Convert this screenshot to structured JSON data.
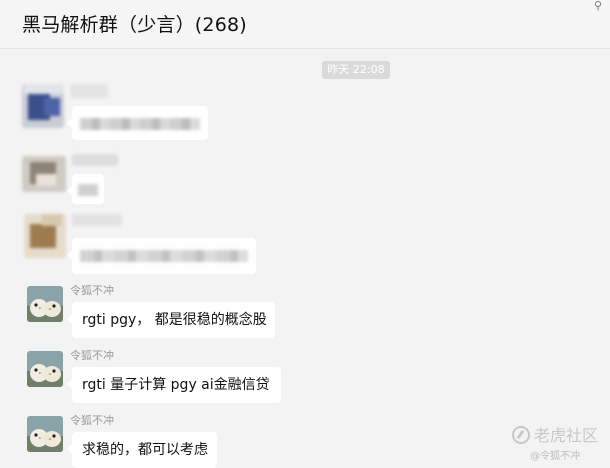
{
  "header": {
    "title": "黑马解析群（少言）(268)",
    "pin_icon": "pin-icon"
  },
  "timestamp": "昨天 22:08",
  "messages": [
    {
      "sender": "",
      "text": "",
      "obscured": true,
      "avatar": "blurred-avatar"
    },
    {
      "sender": "",
      "text": "",
      "obscured": true,
      "avatar": "blurred-avatar"
    },
    {
      "sender": "",
      "text": "",
      "obscured": true,
      "avatar": "blurred-avatar"
    },
    {
      "sender": "令狐不冲",
      "text": "rgti pgy， 都是很稳的概念股",
      "avatar": "bird-avatar"
    },
    {
      "sender": "令狐不冲",
      "text": "rgti 量子计算  pgy ai金融信贷",
      "avatar": "bird-avatar"
    },
    {
      "sender": "令狐不冲",
      "text": "求稳的，都可以考虑",
      "avatar": "bird-avatar"
    }
  ],
  "watermark": {
    "brand": "老虎社区",
    "handle": "@令狐不冲"
  },
  "colors": {
    "background": "#f3f3f3",
    "bubble": "#ffffff",
    "timestamp_badge": "#dadada",
    "sender_name": "#9a9a9a"
  }
}
